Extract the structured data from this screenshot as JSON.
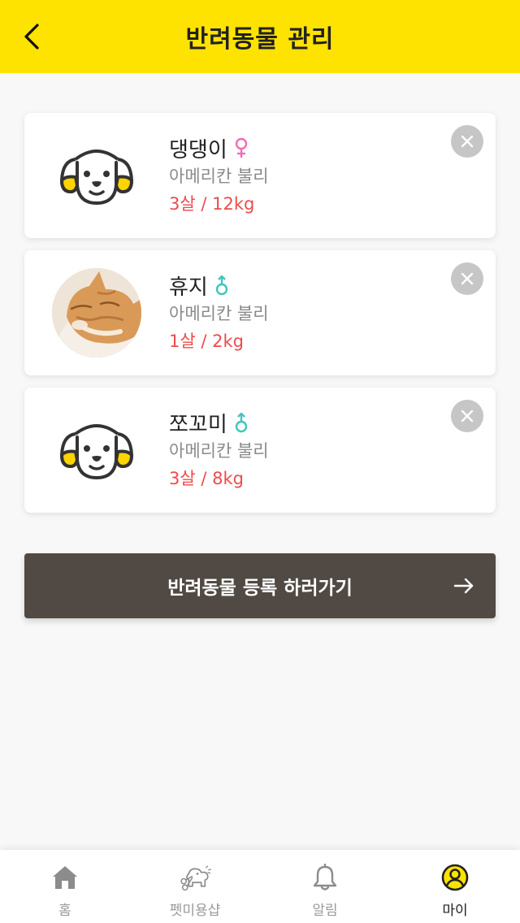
{
  "header": {
    "title": "반려동물 관리"
  },
  "pets": [
    {
      "name": "댕댕이",
      "gender": "female",
      "gender_symbol": "♀",
      "breed": "아메리칸 불리",
      "meta": "3살 / 12kg",
      "avatar": "dog-icon"
    },
    {
      "name": "휴지",
      "gender": "male",
      "gender_symbol": "♂",
      "breed": "아메리칸 불리",
      "meta": "1살 / 2kg",
      "avatar": "cat-photo"
    },
    {
      "name": "쪼꼬미",
      "gender": "male",
      "gender_symbol": "♂",
      "breed": "아메리칸 불리",
      "meta": "3살 / 8kg",
      "avatar": "dog-icon"
    }
  ],
  "register_button": {
    "label": "반려동물 등록 하러가기"
  },
  "bottom_nav": {
    "items": [
      {
        "label": "홈",
        "icon": "home-icon"
      },
      {
        "label": "펫미용샵",
        "icon": "pet-grooming-icon"
      },
      {
        "label": "알림",
        "icon": "bell-icon"
      },
      {
        "label": "마이",
        "icon": "profile-icon",
        "active": true
      }
    ]
  },
  "colors": {
    "header_bg": "#ffe300",
    "cta_bg": "#514a44",
    "meta_text": "#ee4b4b",
    "female": "#f06fb0",
    "male": "#3fc5bd"
  }
}
